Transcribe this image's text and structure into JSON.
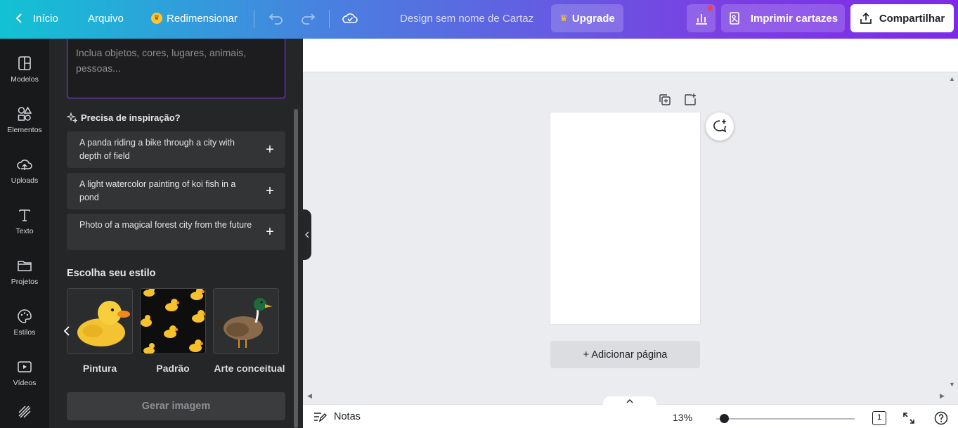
{
  "topbar": {
    "back_label": "Início",
    "file_label": "Arquivo",
    "resize_label": "Redimensionar",
    "doc_title": "Design sem nome de Cartaz",
    "upgrade_label": "Upgrade",
    "print_label": "Imprimir cartazes",
    "share_label": "Compartilhar",
    "colors": {
      "accent": "#7d2ae8",
      "gradient_start": "#12c2d4",
      "notification": "#ff3b3b"
    }
  },
  "rail": {
    "items": [
      {
        "label": "Modelos",
        "icon": "layout-icon"
      },
      {
        "label": "Elementos",
        "icon": "shapes-icon"
      },
      {
        "label": "Uploads",
        "icon": "cloud-upload-icon"
      },
      {
        "label": "Texto",
        "icon": "text-icon"
      },
      {
        "label": "Projetos",
        "icon": "folder-icon"
      },
      {
        "label": "Estilos",
        "icon": "palette-icon"
      },
      {
        "label": "Vídeos",
        "icon": "video-icon"
      }
    ]
  },
  "panel": {
    "prompt_placeholder": "Inclua objetos, cores, lugares, animais, pessoas...",
    "inspiration_title": "Precisa de inspiração?",
    "suggestions": [
      {
        "text": "A panda riding a bike through a city with depth of field"
      },
      {
        "text": "A light watercolor painting of koi fish in a pond"
      },
      {
        "text": "Photo of a magical forest city from the future"
      }
    ],
    "style_title": "Escolha seu estilo",
    "styles": [
      {
        "label": "Pintura"
      },
      {
        "label": "Padrão"
      },
      {
        "label": "Arte conceitual"
      }
    ],
    "generate_label": "Gerar imagem"
  },
  "canvas": {
    "add_page_label": "+ Adicionar página"
  },
  "bottombar": {
    "notes_label": "Notas",
    "zoom": "13%",
    "zoom_fraction": 0.13,
    "page_count": "1"
  }
}
